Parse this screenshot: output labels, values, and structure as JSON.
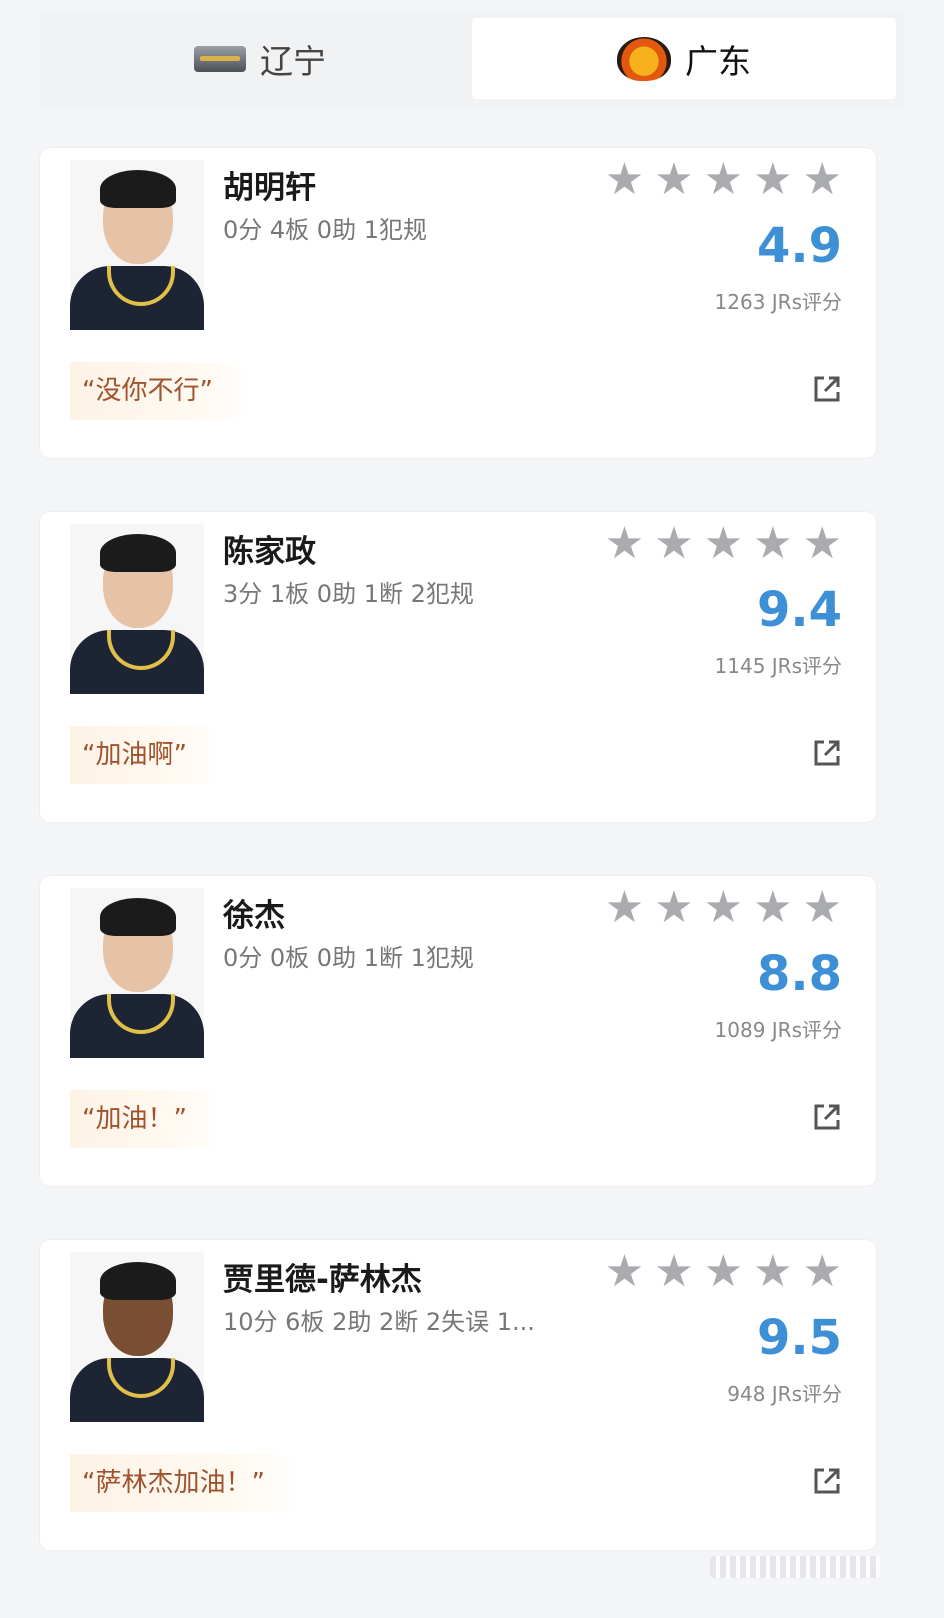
{
  "tabs": [
    {
      "label": "辽宁",
      "logo": "liaoning-leopards-logo",
      "active": false
    },
    {
      "label": "广东",
      "logo": "guangdong-tigers-logo",
      "active": true
    }
  ],
  "players": [
    {
      "name": "胡明轩",
      "stats": "0分 4板 0助 1犯规",
      "stars": 5,
      "score": "4.9",
      "jrs": "1263 JRs评分",
      "quote": "“没你不行”"
    },
    {
      "name": "陈家政",
      "stats": "3分 1板 0助 1断 2犯规",
      "stars": 5,
      "score": "9.4",
      "jrs": "1145 JRs评分",
      "quote": "“加油啊”"
    },
    {
      "name": "徐杰",
      "stats": "0分 0板 0助 1断 1犯规",
      "stars": 5,
      "score": "8.8",
      "jrs": "1089 JRs评分",
      "quote": "“加油！”"
    },
    {
      "name": "贾里德-萨林杰",
      "stats": "10分 6板 2助 2断 2失误 1...",
      "stars": 5,
      "score": "9.5",
      "jrs": "948 JRs评分",
      "quote": "“萨林杰加油！”"
    }
  ],
  "icons": {
    "star": "star-icon",
    "share": "share-external-icon"
  },
  "colors": {
    "score": "#3d8fd6",
    "quote_text": "#a0522d",
    "star": "#a9abaf"
  }
}
